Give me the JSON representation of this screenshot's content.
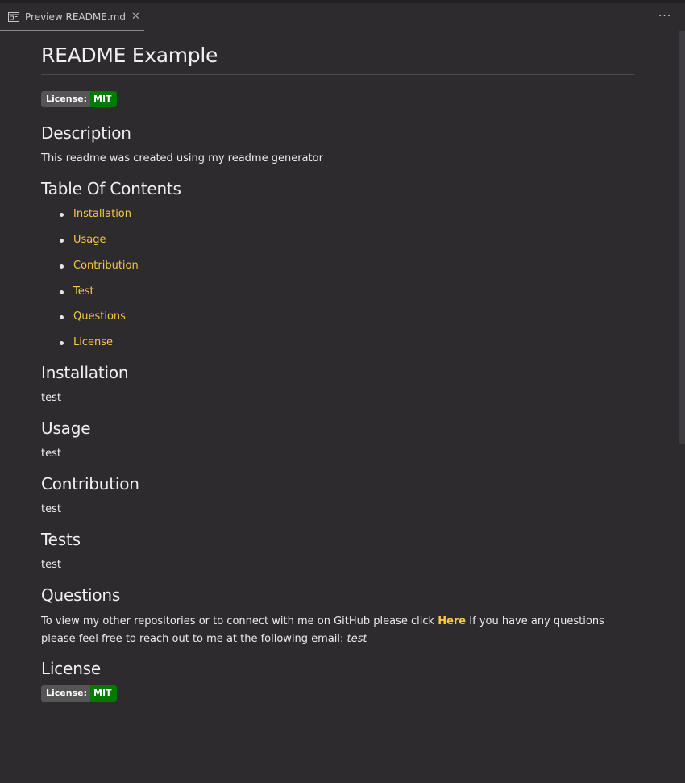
{
  "tab": {
    "label": "Preview README.md",
    "close": "✕"
  },
  "more_label": "···",
  "title": "README Example",
  "badge": {
    "left": "License:",
    "right": "MIT"
  },
  "sections": {
    "description": {
      "heading": "Description",
      "text": "This readme was created using my readme generator"
    },
    "toc": {
      "heading": "Table Of Contents",
      "items": [
        "Installation",
        "Usage",
        "Contribution",
        "Test",
        "Questions",
        "License"
      ]
    },
    "installation": {
      "heading": "Installation",
      "text": "test"
    },
    "usage": {
      "heading": "Usage",
      "text": "test"
    },
    "contribution": {
      "heading": "Contribution",
      "text": "test"
    },
    "tests": {
      "heading": "Tests",
      "text": "test"
    },
    "questions": {
      "heading": "Questions",
      "text_before": "To view my other repositories or to connect with me on GitHub please click ",
      "link": "Here",
      "text_after": " If you have any questions please feel free to reach out to me at the following email: ",
      "email": "test"
    },
    "license": {
      "heading": "License"
    }
  },
  "colors": {
    "background": "#2d2b2e",
    "link": "#f5c842",
    "badge_left": "#555555",
    "badge_right": "#007a00"
  }
}
